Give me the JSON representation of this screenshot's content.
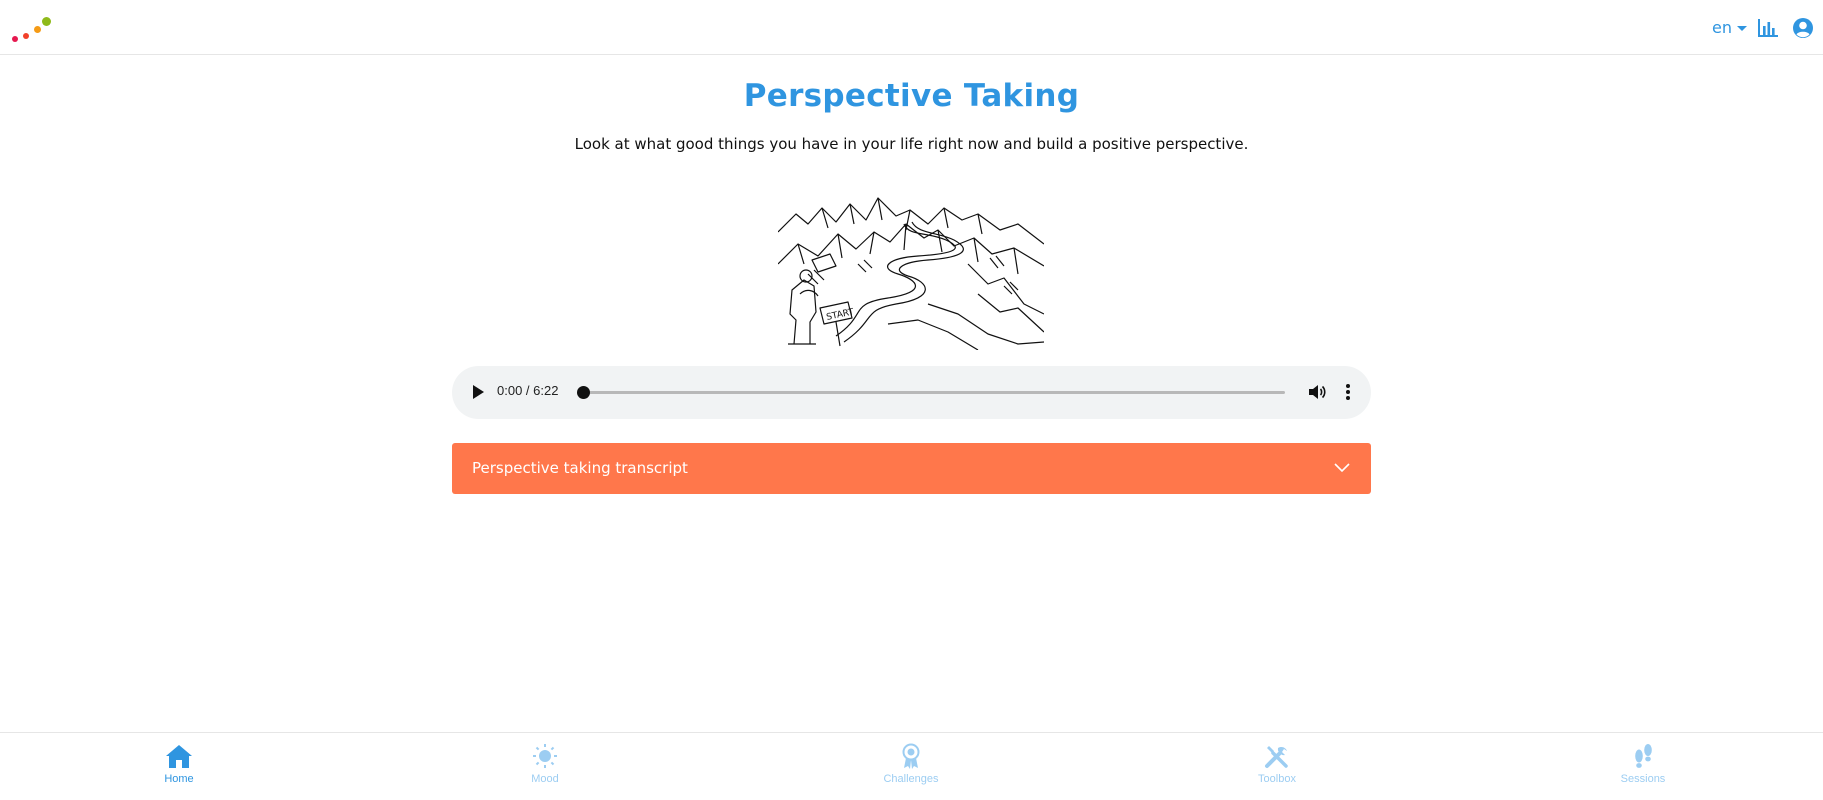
{
  "header": {
    "language": "en",
    "icons": {
      "logo": "dots-logo",
      "stats": "bar-chart-icon",
      "account": "user-circle-icon"
    }
  },
  "main": {
    "title": "Perspective Taking",
    "subtitle": "Look at what good things you have in your life right now and build a positive perspective.",
    "illustration": "mountains-start-sign-illustration"
  },
  "audio": {
    "time_display": "0:00 / 6:22",
    "progress": 0.0
  },
  "accordion": {
    "label": "Perspective taking transcript",
    "expanded": false,
    "color": "#ff774b"
  },
  "bottom_nav": {
    "items": [
      {
        "label": "Home",
        "icon": "home-icon",
        "active": true
      },
      {
        "label": "Mood",
        "icon": "sun-icon",
        "active": false
      },
      {
        "label": "Challenges",
        "icon": "award-icon",
        "active": false
      },
      {
        "label": "Toolbox",
        "icon": "tools-icon",
        "active": false
      },
      {
        "label": "Sessions",
        "icon": "footsteps-icon",
        "active": false
      }
    ]
  },
  "colors": {
    "accent": "#2f95e0",
    "accent_light": "#9ccdf2",
    "accordion": "#ff774b",
    "player_bg": "#f1f3f4"
  }
}
